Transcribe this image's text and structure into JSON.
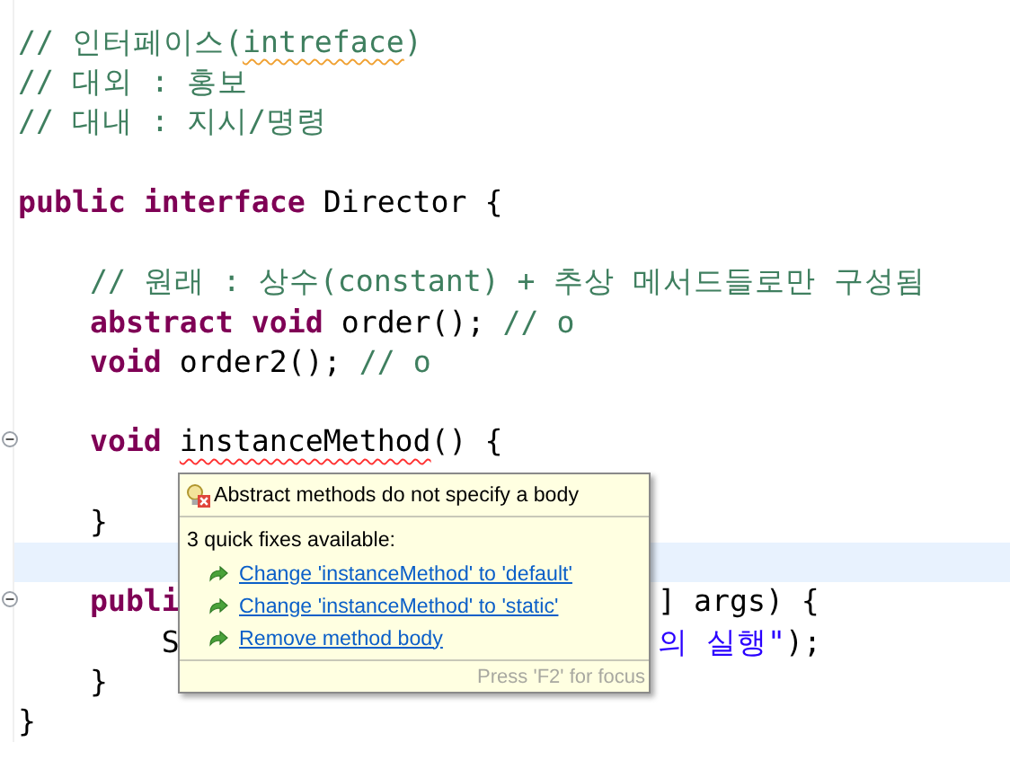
{
  "editor": {
    "lines": [
      {
        "kind": "code",
        "current": false,
        "fold": false,
        "tokens": [
          {
            "text": "// 인터페이스(",
            "kind": "comment"
          },
          {
            "text": "intreface",
            "kind": "comment",
            "warning": true
          },
          {
            "text": ")",
            "kind": "comment"
          }
        ]
      },
      {
        "kind": "code",
        "current": false,
        "fold": false,
        "tokens": [
          {
            "text": "// 대외 : 홍보",
            "kind": "comment"
          }
        ]
      },
      {
        "kind": "code",
        "current": false,
        "fold": false,
        "tokens": [
          {
            "text": "// 대내 : 지시/명령",
            "kind": "comment"
          }
        ]
      },
      {
        "kind": "blank"
      },
      {
        "kind": "code",
        "current": false,
        "fold": false,
        "tokens": [
          {
            "text": "public interface",
            "kind": "keyword"
          },
          {
            "text": " Director {",
            "kind": "plain"
          }
        ]
      },
      {
        "kind": "blank"
      },
      {
        "kind": "code",
        "current": false,
        "fold": false,
        "tokens": [
          {
            "text": "    // 원래 : 상수(constant) + 추상 메서드들로만 구성됨",
            "kind": "comment"
          }
        ]
      },
      {
        "kind": "code",
        "current": false,
        "fold": false,
        "tokens": [
          {
            "text": "    abstract void",
            "kind": "keyword"
          },
          {
            "text": " order(); ",
            "kind": "plain"
          },
          {
            "text": "// o",
            "kind": "comment"
          }
        ]
      },
      {
        "kind": "code",
        "current": false,
        "fold": false,
        "tokens": [
          {
            "text": "    void",
            "kind": "keyword"
          },
          {
            "text": " order2(); ",
            "kind": "plain"
          },
          {
            "text": "// o",
            "kind": "comment"
          }
        ]
      },
      {
        "kind": "blank"
      },
      {
        "kind": "code",
        "current": false,
        "fold": true,
        "tokens": [
          {
            "text": "    void ",
            "kind": "keyword"
          },
          {
            "text": "instanceMethod",
            "kind": "plain",
            "error": true
          },
          {
            "text": "() {",
            "kind": "plain"
          }
        ]
      },
      {
        "kind": "blank"
      },
      {
        "kind": "code",
        "current": false,
        "fold": false,
        "tokens": [
          {
            "text": "    }",
            "kind": "plain"
          }
        ]
      },
      {
        "kind": "blank",
        "current": true
      },
      {
        "kind": "code",
        "current": false,
        "fold": true,
        "tokens": [
          {
            "text": "    publi",
            "kind": "keyword"
          }
        ],
        "tokens_after_popup": [
          {
            "text": "] args) {",
            "kind": "plain"
          }
        ]
      },
      {
        "kind": "code",
        "current": false,
        "fold": false,
        "tokens": [
          {
            "text": "        S",
            "kind": "plain"
          }
        ],
        "tokens_after_popup": [
          {
            "text": "의 실행\"",
            "kind": "string"
          },
          {
            "text": ");",
            "kind": "plain"
          }
        ]
      },
      {
        "kind": "code",
        "current": false,
        "fold": false,
        "tokens": [
          {
            "text": "    }",
            "kind": "plain"
          }
        ]
      },
      {
        "kind": "code",
        "current": false,
        "fold": false,
        "tokens": [
          {
            "text": "}",
            "kind": "plain"
          }
        ]
      }
    ]
  },
  "hover": {
    "title": "Abstract methods do not specify a body",
    "subtitle": "3 quick fixes available:",
    "fixes": [
      "Change 'instanceMethod' to 'default'",
      "Change 'instanceMethod' to 'static'",
      "Remove method body"
    ],
    "footer": "Press 'F2' for focus"
  }
}
